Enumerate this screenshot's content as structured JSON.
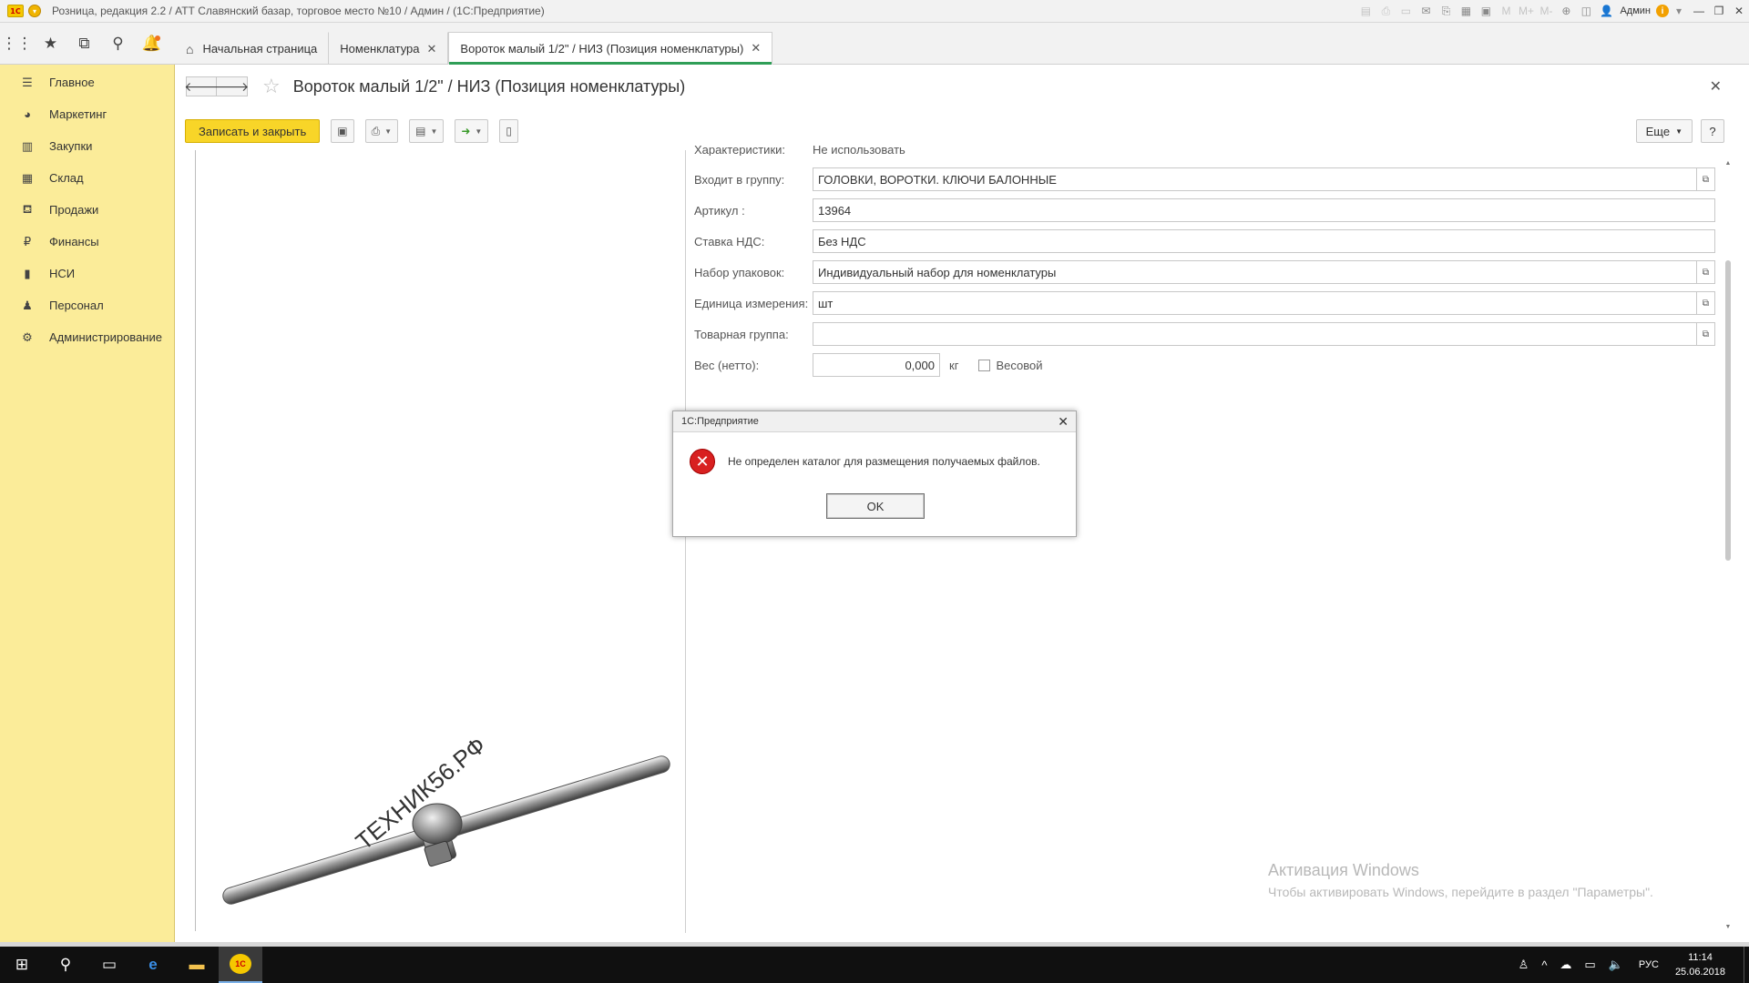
{
  "window": {
    "title": "Розница, редакция 2.2 / АТТ Славянский базар, торговое место №10 / Админ /  (1С:Предприятие)",
    "user": "Админ"
  },
  "tabs": [
    {
      "label": "Начальная страница"
    },
    {
      "label": "Номенклатура"
    },
    {
      "label": "Вороток малый 1/2\" / НИЗ (Позиция номенклатуры)"
    }
  ],
  "sidebar": {
    "items": [
      {
        "label": "Главное",
        "icon": "menu-lines-icon"
      },
      {
        "label": "Маркетинг",
        "icon": "pie-chart-icon"
      },
      {
        "label": "Закупки",
        "icon": "purchases-icon"
      },
      {
        "label": "Склад",
        "icon": "warehouse-icon"
      },
      {
        "label": "Продажи",
        "icon": "basket-icon"
      },
      {
        "label": "Финансы",
        "icon": "ruble-icon"
      },
      {
        "label": "НСИ",
        "icon": "books-icon"
      },
      {
        "label": "Персонал",
        "icon": "person-icon"
      },
      {
        "label": "Администрирование",
        "icon": "gear-icon"
      }
    ]
  },
  "form": {
    "title": "Вороток малый 1/2\" / НИЗ (Позиция номенклатуры)",
    "save_close_label": "Записать и закрыть",
    "more_label": "Еще",
    "help_label": "?"
  },
  "fields": {
    "characteristics": {
      "label": "Характеристики:",
      "value": "Не использовать"
    },
    "group": {
      "label": "Входит в группу:",
      "value": "ГОЛОВКИ, ВОРОТКИ. КЛЮЧИ БАЛОННЫЕ"
    },
    "article": {
      "label": "Артикул :",
      "value": "13964"
    },
    "vat": {
      "label": "Ставка НДС:",
      "value": "Без НДС"
    },
    "packages": {
      "label": "Набор упаковок:",
      "value": "Индивидуальный набор для номенклатуры"
    },
    "unit": {
      "label": "Единица измерения:",
      "value": "шт"
    },
    "product_group": {
      "label": "Товарная группа:",
      "value": ""
    },
    "weight": {
      "label": "Вес (нетто):",
      "value": "0,000",
      "unit": "кг",
      "checkbox_label": "Весовой"
    }
  },
  "image": {
    "watermark_text": "ТЕХНИК56.РФ"
  },
  "activation": {
    "title": "Активация Windows",
    "subtitle": "Чтобы активировать Windows, перейдите в раздел \"Параметры\"."
  },
  "dialog": {
    "title": "1С:Предприятие",
    "message": "Не определен каталог для размещения получаемых файлов.",
    "ok_label": "OK"
  },
  "taskbar": {
    "lang": "РУС",
    "time": "11:14",
    "date": "25.06.2018"
  },
  "colors": {
    "sidebar_bg": "#fbec99",
    "primary_button": "#f8d528",
    "active_tab_accent": "#2f9e57",
    "error_icon": "#d82020"
  }
}
